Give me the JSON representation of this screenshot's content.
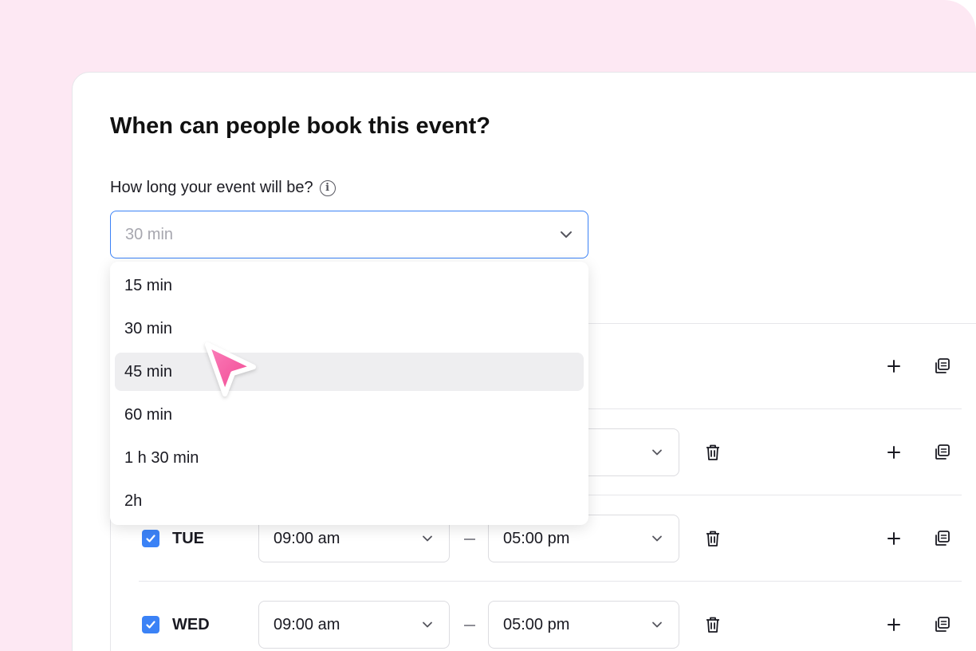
{
  "page": {
    "title": "When can people book this event?",
    "duration_label": "How long your event will be?",
    "info_icon": "i"
  },
  "duration_select": {
    "selected": "30 min",
    "options": [
      "15 min",
      "30 min",
      "45 min",
      "60 min",
      "1 h 30 min",
      "2h"
    ],
    "hovered_option": "45 min"
  },
  "schedule": {
    "rows": [
      {
        "day": "",
        "enabled": true,
        "start": "",
        "end": ""
      },
      {
        "day": "",
        "enabled": true,
        "start": "",
        "end": ""
      },
      {
        "day": "TUE",
        "enabled": true,
        "start": "09:00 am",
        "end": "05:00 pm"
      },
      {
        "day": "WED",
        "enabled": true,
        "start": "09:00 am",
        "end": "05:00 pm"
      }
    ]
  },
  "colors": {
    "accent": "#3b82f6",
    "background_pink": "#fde8f3",
    "cursor_pink": "#f7559b"
  }
}
